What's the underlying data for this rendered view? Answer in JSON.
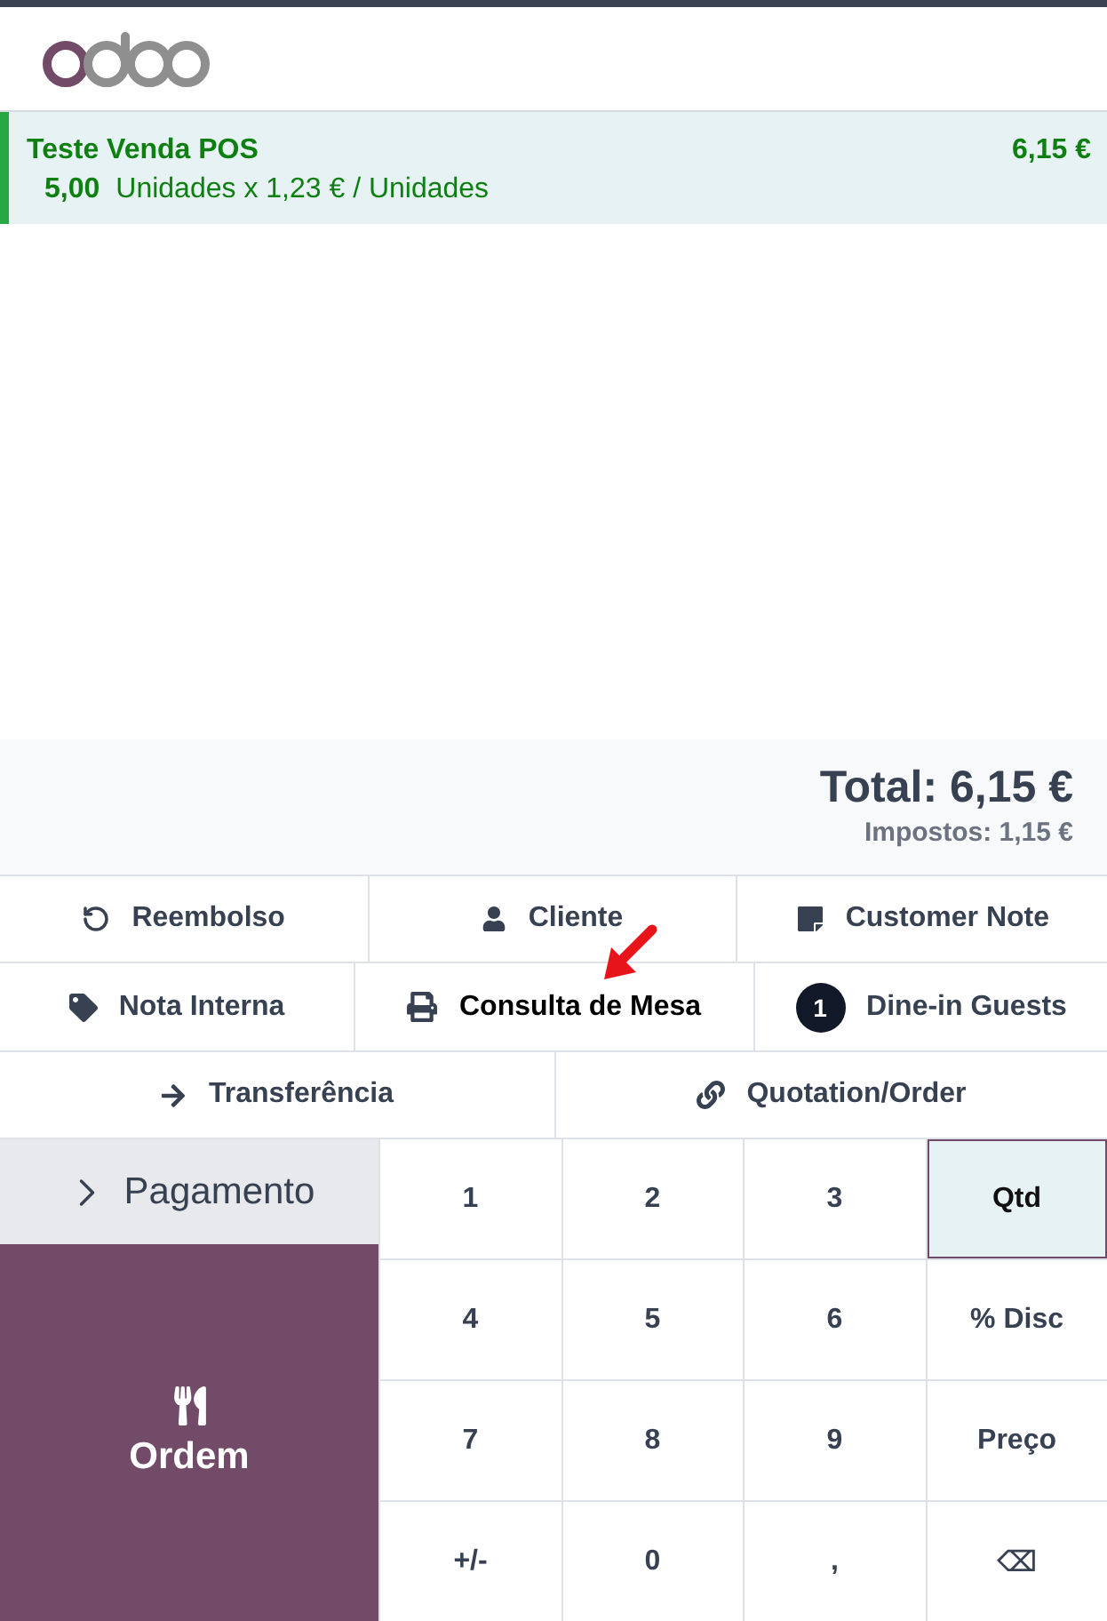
{
  "order_lines": [
    {
      "product": "Teste Venda POS",
      "price": "6,15 €",
      "quantity": "5,00",
      "unit_info": "Unidades x 1,23 € / Unidades",
      "selected": true
    }
  ],
  "totals": {
    "total": "Total: 6,15 €",
    "taxes": "Impostos: 1,15 €"
  },
  "control_buttons": [
    [
      {
        "label": "Reembolso",
        "highlighted": false
      },
      {
        "label": "Cliente",
        "highlighted": false
      },
      {
        "label": "Customer Note",
        "highlighted": false
      }
    ],
    [
      {
        "label": "Nota Interna",
        "highlighted": false
      },
      {
        "label": "Consulta de Mesa",
        "highlighted": true
      },
      {
        "label": "Dine-in Guests",
        "badge": "1",
        "highlighted": false
      }
    ],
    [
      {
        "label": "Transferência",
        "highlighted": false
      },
      {
        "label": "Quotation/Order",
        "highlighted": false
      }
    ]
  ],
  "payment_button": {
    "label": "Pagamento"
  },
  "order_button": {
    "label": "Ordem"
  },
  "numpad": {
    "keys": [
      {
        "label": "1",
        "selected": false
      },
      {
        "label": "2",
        "selected": false
      },
      {
        "label": "3",
        "selected": false
      },
      {
        "label": "Qtd",
        "selected": true
      },
      {
        "label": "4",
        "selected": false
      },
      {
        "label": "5",
        "selected": false
      },
      {
        "label": "6",
        "selected": false
      },
      {
        "label": "% Disc",
        "selected": false
      },
      {
        "label": "7",
        "selected": false
      },
      {
        "label": "8",
        "selected": false
      },
      {
        "label": "9",
        "selected": false
      },
      {
        "label": "Preço",
        "selected": false
      },
      {
        "label": "+/-",
        "selected": false
      },
      {
        "label": "0",
        "selected": false
      },
      {
        "label": ",",
        "selected": false
      },
      {
        "label": "⌫",
        "selected": false
      }
    ]
  }
}
